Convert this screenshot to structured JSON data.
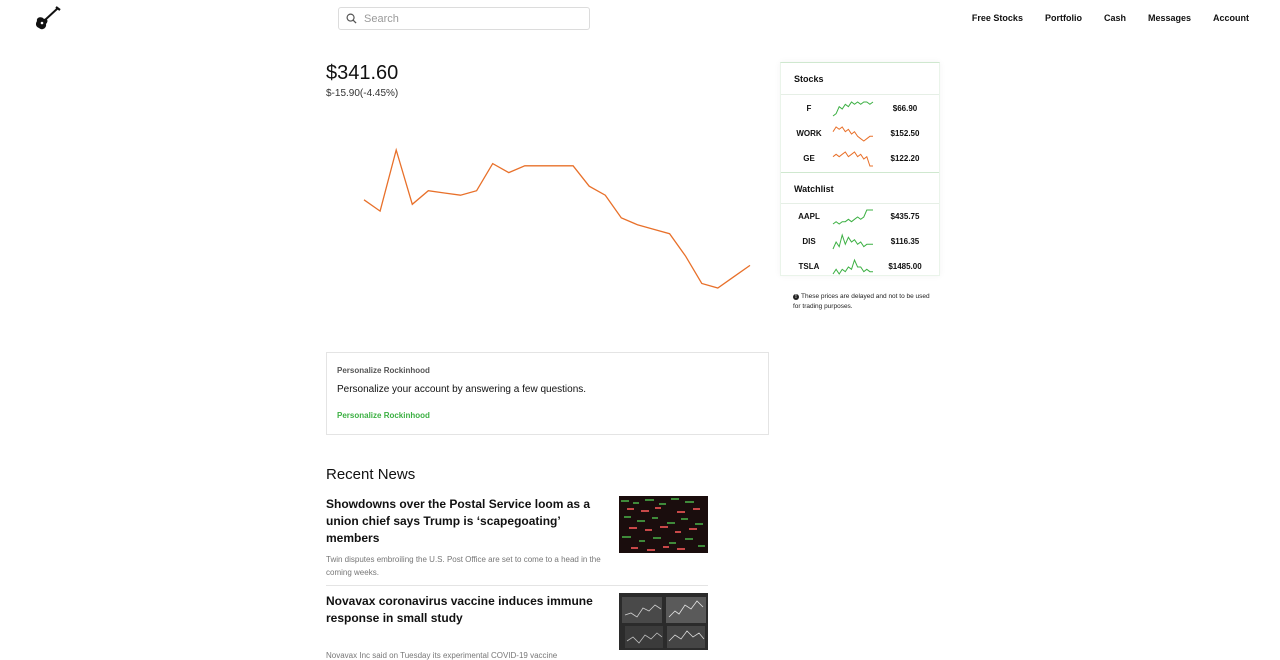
{
  "header": {
    "search_placeholder": "Search",
    "nav": [
      "Free Stocks",
      "Portfolio",
      "Cash",
      "Messages",
      "Account"
    ]
  },
  "portfolio": {
    "value": "$341.60",
    "change": "$-15.90(-4.45%)",
    "line_color": "#e8702a",
    "series": [
      360,
      355,
      382,
      358,
      364,
      363,
      362,
      364,
      376,
      372,
      375,
      375,
      375,
      375,
      366,
      362,
      352,
      349,
      347,
      345,
      335,
      323,
      321,
      326,
      331
    ]
  },
  "personalize": {
    "title": "Personalize Rockinhood",
    "text": "Personalize your account by answering a few questions.",
    "link": "Personalize Rockinhood"
  },
  "news": {
    "heading": "Recent News",
    "items": [
      {
        "title": "Showdowns over the Postal Service loom as a union chief says Trump is ‘scapegoating’ members",
        "summary": "Twin disputes embroiling the U.S. Post Office are set to come to a head in the coming weeks."
      },
      {
        "title": "Novavax coronavirus vaccine induces immune response in small study",
        "summary": "Novavax Inc said on Tuesday its experimental COVID-19 vaccine"
      }
    ]
  },
  "sidebar": {
    "stocks_heading": "Stocks",
    "watchlist_heading": "Watchlist",
    "stocks": [
      {
        "symbol": "F",
        "price": "$66.90",
        "trend": "up",
        "color": "#3cb043",
        "spark": [
          2,
          3,
          6,
          5,
          7,
          6,
          8,
          7,
          8,
          7,
          8,
          8,
          7,
          8
        ]
      },
      {
        "symbol": "WORK",
        "price": "$152.50",
        "trend": "down",
        "color": "#e8702a",
        "spark": [
          6,
          8,
          7,
          8,
          6,
          7,
          5,
          6,
          4,
          3,
          2,
          3,
          4,
          4
        ]
      },
      {
        "symbol": "GE",
        "price": "$122.20",
        "trend": "down",
        "color": "#e8702a",
        "spark": [
          6,
          7,
          6,
          7,
          8,
          6,
          7,
          8,
          6,
          7,
          5,
          6,
          2,
          2
        ]
      }
    ],
    "watchlist": [
      {
        "symbol": "AAPL",
        "price": "$435.75",
        "trend": "up",
        "color": "#3cb043",
        "spark": [
          3,
          4,
          3,
          4,
          4,
          5,
          4,
          5,
          6,
          5,
          6,
          9,
          9,
          9
        ]
      },
      {
        "symbol": "DIS",
        "price": "$116.35",
        "trend": "up",
        "color": "#3cb043",
        "spark": [
          3,
          6,
          4,
          9,
          5,
          8,
          6,
          7,
          5,
          6,
          4,
          5,
          5,
          5
        ]
      },
      {
        "symbol": "TSLA",
        "price": "$1485.00",
        "trend": "up",
        "color": "#3cb043",
        "spark": [
          3,
          5,
          3,
          5,
          4,
          6,
          5,
          9,
          6,
          6,
          4,
          5,
          4,
          4
        ]
      }
    ],
    "disclaimer": "These prices are delayed and not to be used for trading purposes."
  }
}
